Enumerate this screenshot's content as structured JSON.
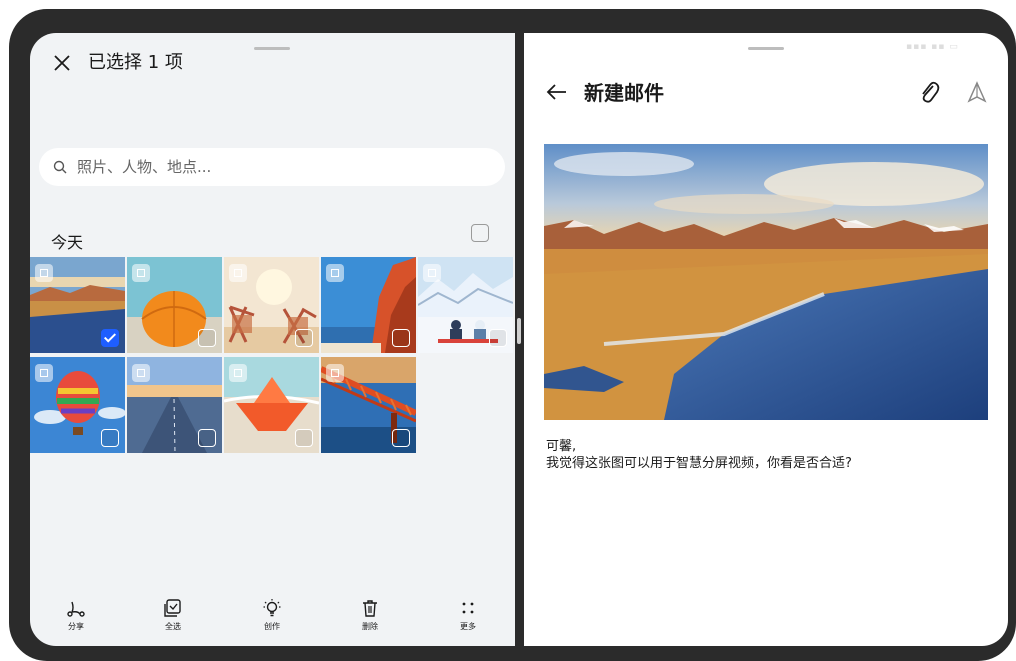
{
  "left_pane": {
    "title": "已选择 1 项",
    "search": {
      "placeholder": "照片、人物、地点..."
    },
    "date_group": "今天",
    "photos": [
      {
        "name": "lake-mountains",
        "selected": true
      },
      {
        "name": "orange-umbrella",
        "selected": false
      },
      {
        "name": "beach-chairs",
        "selected": false
      },
      {
        "name": "red-cliff",
        "selected": false
      },
      {
        "name": "snow-skiers",
        "selected": false
      },
      {
        "name": "hot-air-balloon",
        "selected": false
      },
      {
        "name": "road-sunset",
        "selected": false
      },
      {
        "name": "paper-boat",
        "selected": false
      },
      {
        "name": "bridge-sunset",
        "selected": false
      }
    ],
    "toolbar": {
      "share": "分享",
      "select_all": "全选",
      "create": "创作",
      "delete": "删除",
      "more": "更多"
    }
  },
  "right_pane": {
    "title": "新建邮件",
    "body_line1": "可馨,",
    "body_line2": "我觉得这张图可以用于智慧分屏视频，你看是否合适?"
  },
  "colors": {
    "accent": "#1e5eff",
    "frame": "#2b2b2b",
    "left_bg": "#f1f3f5"
  }
}
